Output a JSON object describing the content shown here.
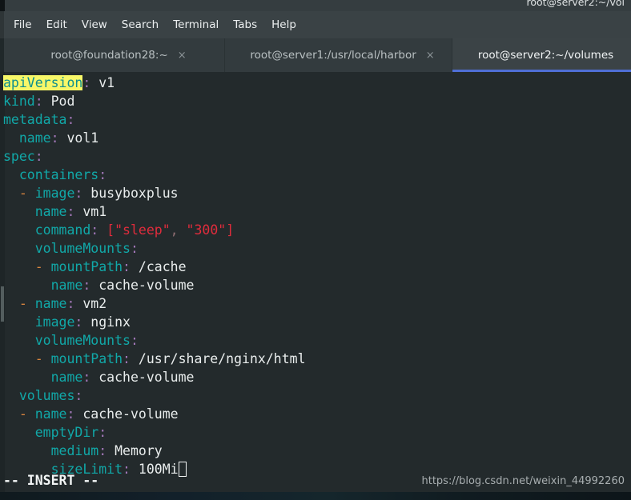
{
  "window": {
    "titlebar_text": "root@server2:~/vol"
  },
  "menubar": {
    "items": [
      {
        "label": "File"
      },
      {
        "label": "Edit"
      },
      {
        "label": "View"
      },
      {
        "label": "Search"
      },
      {
        "label": "Terminal"
      },
      {
        "label": "Tabs"
      },
      {
        "label": "Help"
      }
    ]
  },
  "tabs": {
    "close_glyph": "×",
    "items": [
      {
        "label": "root@foundation28:~",
        "active": false,
        "closable": true
      },
      {
        "label": "root@server1:/usr/local/harbor",
        "active": false,
        "closable": true
      },
      {
        "label": "root@server2:~/volumes",
        "active": true,
        "closable": false
      }
    ]
  },
  "editor": {
    "filetype": "yaml",
    "search_highlight": "apiVersion",
    "cursor_after_text": "100Mi",
    "lines": [
      {
        "indent": 0,
        "dash": false,
        "key": "apiVersion",
        "value": "v1",
        "highlight_key": true
      },
      {
        "indent": 0,
        "dash": false,
        "key": "kind",
        "value": "Pod"
      },
      {
        "indent": 0,
        "dash": false,
        "key": "metadata",
        "value": ""
      },
      {
        "indent": 1,
        "dash": false,
        "key": "name",
        "value": "vol1"
      },
      {
        "indent": 0,
        "dash": false,
        "key": "spec",
        "value": ""
      },
      {
        "indent": 1,
        "dash": false,
        "key": "containers",
        "value": ""
      },
      {
        "indent": 1,
        "dash": true,
        "key": "image",
        "value": "busyboxplus"
      },
      {
        "indent": 2,
        "dash": false,
        "key": "name",
        "value": "vm1"
      },
      {
        "indent": 2,
        "dash": false,
        "key": "command",
        "value": "[\"sleep\", \"300\"]",
        "value_kind": "flow-seq"
      },
      {
        "indent": 2,
        "dash": false,
        "key": "volumeMounts",
        "value": ""
      },
      {
        "indent": 2,
        "dash": true,
        "key": "mountPath",
        "value": "/cache"
      },
      {
        "indent": 3,
        "dash": false,
        "key": "name",
        "value": "cache-volume"
      },
      {
        "indent": 1,
        "dash": true,
        "key": "name",
        "value": "vm2"
      },
      {
        "indent": 2,
        "dash": false,
        "key": "image",
        "value": "nginx"
      },
      {
        "indent": 2,
        "dash": false,
        "key": "volumeMounts",
        "value": ""
      },
      {
        "indent": 2,
        "dash": true,
        "key": "mountPath",
        "value": "/usr/share/nginx/html"
      },
      {
        "indent": 3,
        "dash": false,
        "key": "name",
        "value": "cache-volume"
      },
      {
        "indent": 1,
        "dash": false,
        "key": "volumes",
        "value": ""
      },
      {
        "indent": 1,
        "dash": true,
        "key": "name",
        "value": "cache-volume"
      },
      {
        "indent": 2,
        "dash": false,
        "key": "emptyDir",
        "value": ""
      },
      {
        "indent": 3,
        "dash": false,
        "key": "medium",
        "value": "Memory"
      },
      {
        "indent": 3,
        "dash": false,
        "key": "sizeLimit",
        "value": "100Mi",
        "cursor": true
      }
    ]
  },
  "statusline": {
    "mode": "-- INSERT --",
    "watermark": "https://blog.csdn.net/weixin_44992260"
  },
  "colors": {
    "terminal_background": "#232a2c",
    "chrome_background": "#2b3335",
    "menubar_background": "#3a4245",
    "tab_inactive_background": "#333b3e",
    "tab_active_background": "#3b4346",
    "tab_active_underline": "#4f6fd6",
    "yaml_key": "#11a8a8",
    "yaml_colon": "#a277b8",
    "yaml_value": "#e9eded",
    "yaml_dash": "#d8853f",
    "yaml_string": "#e02c3c",
    "search_highlight_bg": "#f7f768",
    "search_highlight_fg": "#0e8f8f",
    "cursor_outline": "#f0f3f3",
    "watermark_text": "#a8aeb0"
  }
}
